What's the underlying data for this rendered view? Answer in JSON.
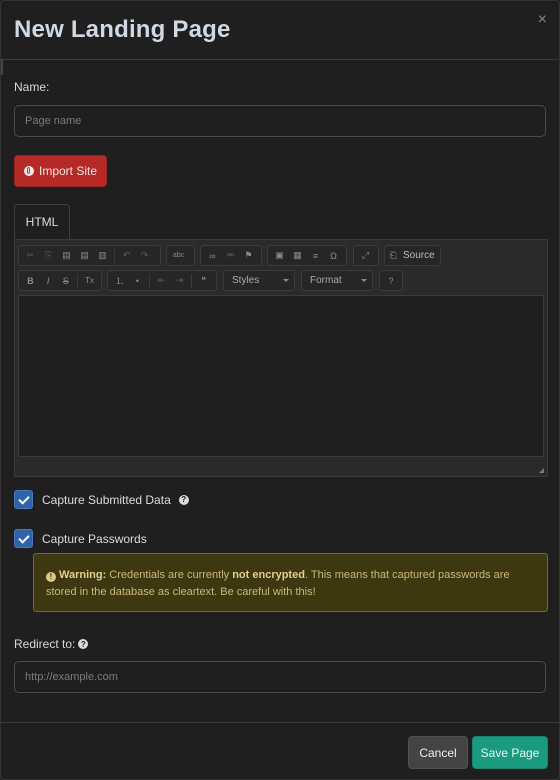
{
  "modal": {
    "title": "New Landing Page",
    "close_glyph": "×"
  },
  "name_field": {
    "label": "Name:",
    "placeholder": "Page name",
    "value": ""
  },
  "import_button": {
    "label": "Import Site",
    "icon": "globe-icon",
    "color": "#b52a26"
  },
  "tabs": [
    {
      "label": "HTML",
      "active": true
    }
  ],
  "editor": {
    "toolbar_row1": {
      "group1": [
        {
          "icon": "cut-icon",
          "glyph": "✂"
        },
        {
          "icon": "copy-icon",
          "glyph": "⎘"
        },
        {
          "icon": "paste-icon",
          "glyph": "📋"
        },
        {
          "icon": "paste-text-icon",
          "glyph": "▤"
        },
        {
          "icon": "paste-word-icon",
          "glyph": "▥"
        },
        {
          "icon": "undo-icon",
          "glyph": "↶"
        },
        {
          "icon": "redo-icon",
          "glyph": "↷"
        }
      ],
      "group2": [
        {
          "icon": "spellcheck-icon",
          "glyph": "abc"
        }
      ],
      "group3": [
        {
          "icon": "link-icon",
          "glyph": "∞"
        },
        {
          "icon": "unlink-icon",
          "glyph": "⚮"
        },
        {
          "icon": "anchor-icon",
          "glyph": "⚑"
        }
      ],
      "group4": [
        {
          "icon": "image-icon",
          "glyph": "▣"
        },
        {
          "icon": "table-icon",
          "glyph": "▦"
        },
        {
          "icon": "horizontal-line-icon",
          "glyph": "≡"
        },
        {
          "icon": "special-char-icon",
          "glyph": "Ω"
        }
      ],
      "group5": [
        {
          "icon": "maximize-icon",
          "glyph": "⤢"
        }
      ],
      "source_label": "Source"
    },
    "toolbar_row2": {
      "group1": [
        {
          "icon": "bold-icon",
          "glyph": "B"
        },
        {
          "icon": "italic-icon",
          "glyph": "I"
        },
        {
          "icon": "strike-icon",
          "glyph": "S"
        },
        {
          "icon": "remove-format-icon",
          "glyph": "Tx"
        }
      ],
      "group2": [
        {
          "icon": "numbered-list-icon",
          "glyph": "⒈"
        },
        {
          "icon": "bulleted-list-icon",
          "glyph": "•"
        },
        {
          "icon": "outdent-icon",
          "glyph": "⇤"
        },
        {
          "icon": "indent-icon",
          "glyph": "⇥"
        },
        {
          "icon": "blockquote-icon",
          "glyph": "❝"
        }
      ],
      "styles_label": "Styles",
      "format_label": "Format",
      "help_glyph": "?"
    },
    "content": ""
  },
  "capture_data": {
    "label": "Capture Submitted Data",
    "checked": true,
    "help_icon": "question-circle-icon"
  },
  "capture_passwords": {
    "label": "Capture Passwords",
    "checked": true
  },
  "warning": {
    "title": "Warning:",
    "text_before": " Credentials are currently ",
    "emphasis": "not encrypted",
    "text_after": ". This means that captured passwords are stored in the database as cleartext. Be careful with this!",
    "icon": "exclamation-circle-icon",
    "glyph": "!"
  },
  "redirect": {
    "label": "Redirect to:",
    "placeholder": "http://example.com",
    "value": "",
    "help_icon": "question-circle-icon"
  },
  "footer": {
    "cancel_label": "Cancel",
    "save_label": "Save Page"
  },
  "colors": {
    "background": "#1f1f1f",
    "primary_check": "#2f63a8",
    "save": "#1a9a7e",
    "danger": "#b52a26",
    "warning_bg": "#3d3810"
  }
}
